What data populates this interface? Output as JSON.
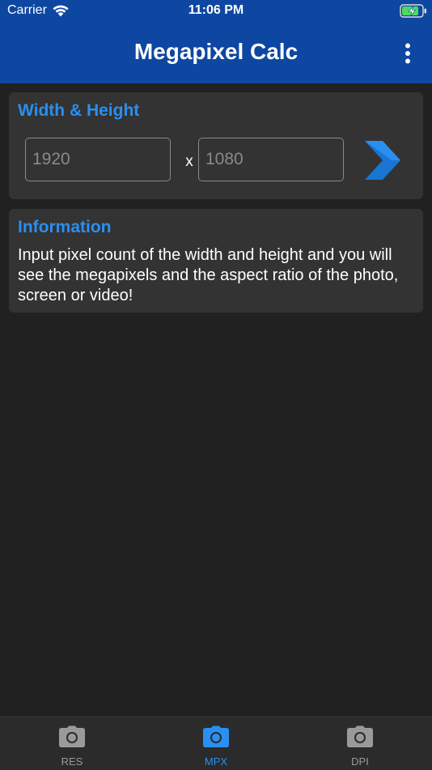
{
  "status_bar": {
    "carrier": "Carrier",
    "time": "11:06 PM",
    "icons": [
      "wifi-icon",
      "battery-charging-icon"
    ]
  },
  "app_bar": {
    "title": "Megapixel Calc",
    "menu_icon": "more-vertical-icon"
  },
  "width_height_card": {
    "title": "Width & Height",
    "width_placeholder": "1920",
    "height_placeholder": "1080",
    "separator": "x",
    "go_icon": "chevron-right-icon"
  },
  "info_card": {
    "title": "Information",
    "text": "Input pixel count of the width and height and you will see the megapixels and the aspect ratio of the photo, screen or video!"
  },
  "tabs": [
    {
      "label": "RES",
      "icon": "camera-icon",
      "active": false
    },
    {
      "label": "MPX",
      "icon": "camera-icon",
      "active": true
    },
    {
      "label": "DPI",
      "icon": "camera-icon",
      "active": false
    }
  ],
  "colors": {
    "app_bar": "#0d47a1",
    "background": "#212121",
    "card": "#333333",
    "accent": "#2a8ff0",
    "inactive": "#9a9a9a"
  }
}
